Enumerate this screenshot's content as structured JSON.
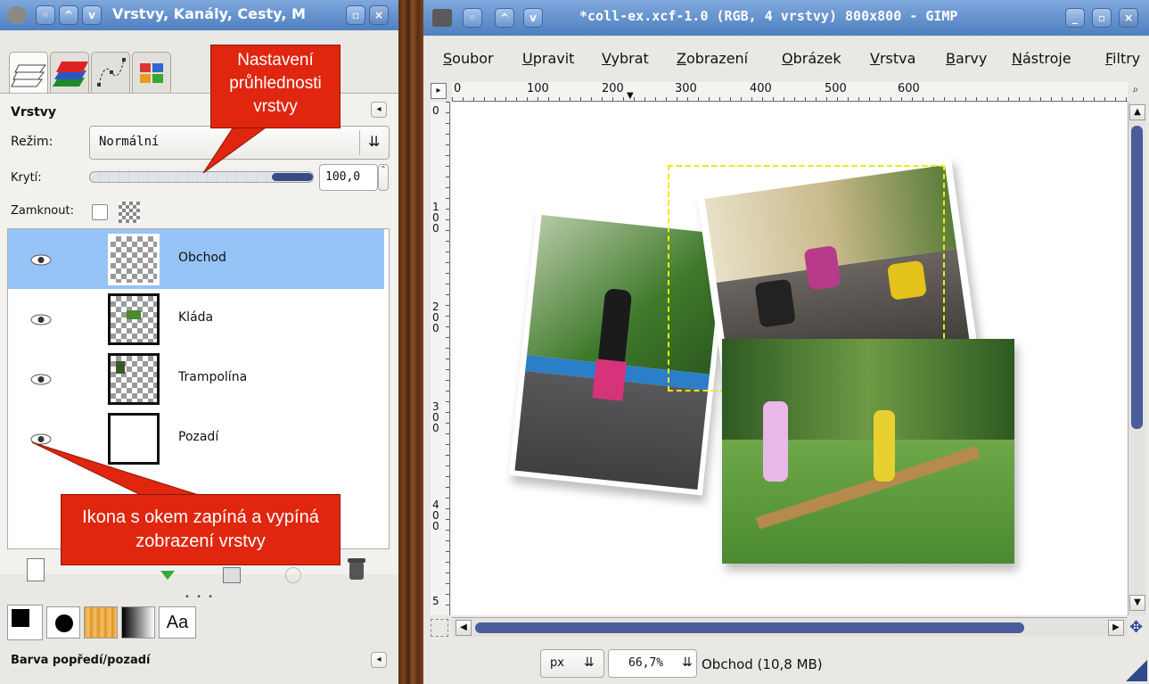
{
  "dock": {
    "title": "Vrstvy, Kanály, Cesty, M",
    "section_title": "Vrstvy",
    "mode_label": "Režim:",
    "mode_value": "Normální",
    "opacity_label": "Krytí:",
    "opacity_value": "100,0",
    "opacity_fraction": 1.0,
    "lock_label": "Zamknout:",
    "layers": [
      {
        "name": "Obchod",
        "visible": true,
        "selected": true
      },
      {
        "name": "Kláda",
        "visible": true,
        "selected": false
      },
      {
        "name": "Trampolína",
        "visible": true,
        "selected": false
      },
      {
        "name": "Pozadí",
        "visible": true,
        "selected": false
      }
    ],
    "fgbg_title": "Barva popředí/pozadí",
    "font_tab_label": "Aa"
  },
  "callouts": {
    "opacity": "Nastavení průhlednosti vrstvy",
    "eye": "Ikona s okem zapíná a vypíná zobrazení vrstvy"
  },
  "image_window": {
    "title": "*coll-ex.xcf-1.0 (RGB, 4 vrstvy) 800x800 - GIMP",
    "menu": [
      {
        "key": "S",
        "rest": "oubor"
      },
      {
        "key": "U",
        "rest": "pravit"
      },
      {
        "key": "V",
        "rest": "ybrat"
      },
      {
        "key": "Z",
        "rest": "obrazení"
      },
      {
        "key": "O",
        "rest": "brázek"
      },
      {
        "key": "V",
        "rest": "rstva"
      },
      {
        "key": "B",
        "rest": "arvy"
      },
      {
        "key": "N",
        "rest": "ástroje"
      },
      {
        "key": "F",
        "rest": "iltry"
      }
    ],
    "ruler_top": [
      "0",
      "100",
      "200",
      "300",
      "400",
      "500",
      "600"
    ],
    "ruler_left": [
      "0",
      "1 0 0",
      "2 0 0",
      "3 0 0",
      "4 0 0",
      "5"
    ],
    "status": {
      "unit": "px",
      "zoom": "66,7%",
      "layer_info": "Obchod (10,8 MB)"
    }
  },
  "colors": {
    "title_blue": "#5b86c4",
    "selected_layer": "#96c3f5",
    "callout_red": "#e0260f",
    "scrollbar": "#4a5c9a"
  }
}
